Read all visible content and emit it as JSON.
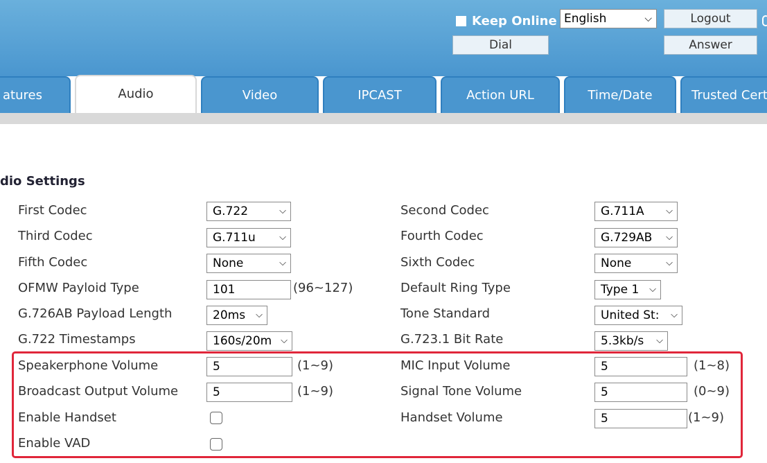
{
  "header": {
    "keep_online": "Keep Online",
    "language": "English",
    "logout": "Logout",
    "dial": "Dial",
    "answer": "Answer"
  },
  "tabs": [
    {
      "label": "atures"
    },
    {
      "label": "Audio"
    },
    {
      "label": "Video"
    },
    {
      "label": "IPCAST"
    },
    {
      "label": "Action URL"
    },
    {
      "label": "Time/Date"
    },
    {
      "label": "Trusted Cert"
    }
  ],
  "section_title": "dio Settings",
  "rows": [
    {
      "left_label": "First Codec",
      "left_value": "G.722",
      "right_label": "Second Codec",
      "right_value": "G.711A"
    },
    {
      "left_label": "Third Codec",
      "left_value": "G.711u",
      "right_label": "Fourth Codec",
      "right_value": "G.729AB"
    },
    {
      "left_label": "Fifth Codec",
      "left_value": "None",
      "right_label": "Sixth Codec",
      "right_value": "None"
    },
    {
      "left_label": "OFMW Payloid Type",
      "left_value": "101",
      "left_range": "(96~127)",
      "right_label": "Default Ring Type",
      "right_value": "Type 1"
    },
    {
      "left_label": "G.726AB Payload Length",
      "left_value": "20ms",
      "right_label": "Tone Standard",
      "right_value": "United St:"
    },
    {
      "left_label": "G.722 Timestamps",
      "left_value": "160s/20m",
      "right_label": "G.723.1 Bit Rate",
      "right_value": "5.3kb/s"
    },
    {
      "left_label": "Speakerphone Volume",
      "left_value": "5",
      "left_range": "(1~9)",
      "right_label": "MIC Input Volume",
      "right_value": "5",
      "right_range": "(1~8)"
    },
    {
      "left_label": "Broadcast Output Volume",
      "left_value": "5",
      "left_range": "(1~9)",
      "right_label": "Signal Tone Volume",
      "right_value": "5",
      "right_range": "(0~9)"
    },
    {
      "left_label": "Enable Handset",
      "left_checked": false,
      "right_label": "Handset Volume",
      "right_value": "5",
      "right_range": "(1~9)"
    },
    {
      "left_label": "Enable VAD",
      "left_checked": false
    }
  ],
  "colors": {
    "header": "#4a96cf",
    "highlight": "#e0263a"
  }
}
